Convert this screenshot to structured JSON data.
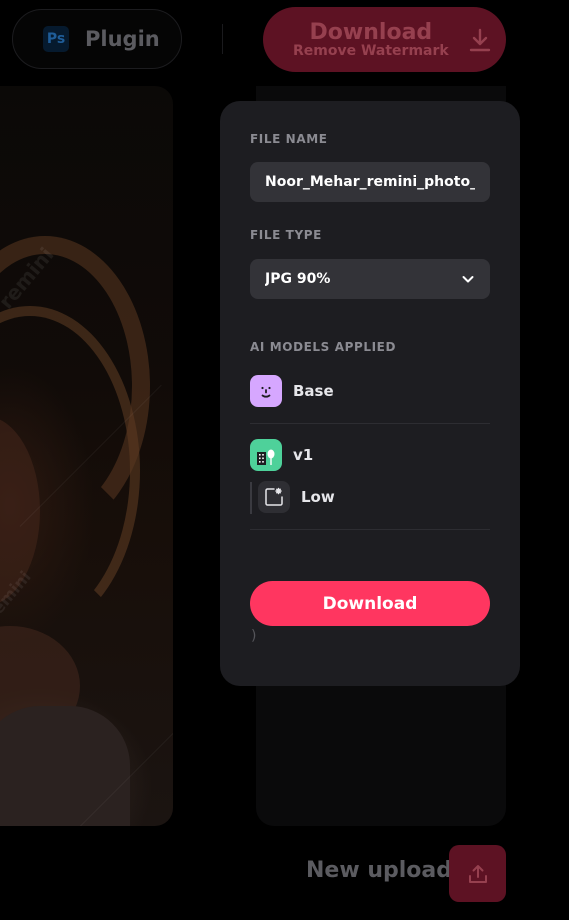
{
  "header": {
    "plugin_badge": "Ps",
    "plugin_label": "Plugin",
    "download_wm_title": "Download",
    "download_wm_subtitle": "Remove Watermark"
  },
  "watermark_text": "remini",
  "footer": {
    "new_upload_label": "New upload"
  },
  "modal": {
    "file_name_label": "FILE NAME",
    "file_name_value": "Noor_Mehar_remini_photo_enhanced",
    "file_type_label": "FILE TYPE",
    "file_type_value": "JPG 90%",
    "ai_models_label": "AI MODELS APPLIED",
    "models": [
      {
        "label": "Base",
        "icon": "face-icon",
        "color": "#d6a7ff"
      },
      {
        "label": "v1",
        "icon": "landscape-icon",
        "color": "#4ed19a"
      },
      {
        "label": "Low",
        "icon": "sparkle-frame-icon",
        "color": "#2e2e33"
      }
    ],
    "download_label": "Download",
    "stray_char": ")"
  },
  "colors": {
    "accent": "#ff3660",
    "modal_bg": "#1d1d21",
    "field_bg": "#333338"
  }
}
